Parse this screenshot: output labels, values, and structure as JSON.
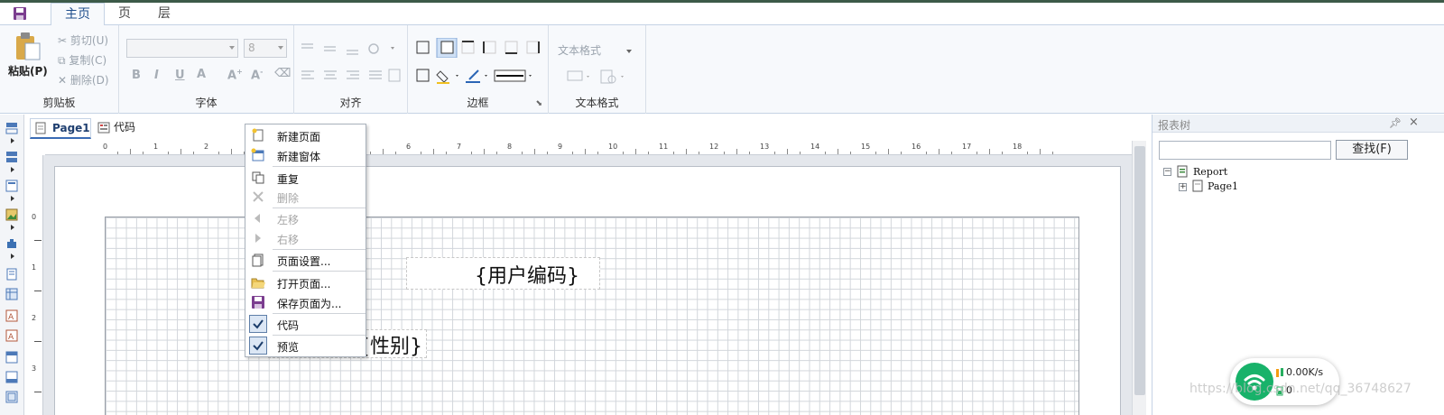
{
  "menu": {
    "tabs": [
      {
        "label": "主页",
        "active": true
      },
      {
        "label": "页",
        "active": false
      },
      {
        "label": "层",
        "active": false
      }
    ]
  },
  "ribbon": {
    "clipboard": {
      "paste": "粘贴(P)",
      "cut": "剪切(U)",
      "copy": "复制(C)",
      "delete": "删除(D)",
      "label": "剪贴板"
    },
    "font": {
      "size_value": "8",
      "label": "字体"
    },
    "align": {
      "label": "对齐"
    },
    "border": {
      "label": "边框"
    },
    "text_format": {
      "combo": "文本格式",
      "label": "文本格式"
    }
  },
  "doc_tabs": [
    {
      "label": "Page1",
      "active": true
    },
    {
      "label": "代码",
      "active": false
    }
  ],
  "ruler": {
    "h_numbers": [
      "0",
      "1",
      "2",
      "3",
      "4",
      "5",
      "6",
      "7",
      "8",
      "9",
      "10",
      "11",
      "12",
      "13",
      "14",
      "15",
      "16",
      "17",
      "18"
    ],
    "v_numbers": [
      "0",
      "1",
      "2",
      "3"
    ]
  },
  "canvas": {
    "fields": [
      "{用户编码}",
      "{性别}"
    ]
  },
  "context_menu": {
    "items": [
      {
        "label": "新建页面",
        "enabled": true
      },
      {
        "label": "新建窗体",
        "enabled": true
      },
      {
        "label": "重复",
        "enabled": true
      },
      {
        "label": "删除",
        "enabled": false
      },
      {
        "label": "左移",
        "enabled": false
      },
      {
        "label": "右移",
        "enabled": false
      },
      {
        "label": "页面设置...",
        "enabled": true
      },
      {
        "label": "打开页面...",
        "enabled": true
      },
      {
        "label": "保存页面为...",
        "enabled": true
      },
      {
        "label": "代码",
        "enabled": true,
        "checked": true
      },
      {
        "label": "预览",
        "enabled": true,
        "checked": true
      }
    ]
  },
  "report_tree": {
    "title": "报表树",
    "find_button": "查找(F)",
    "search_value": "",
    "nodes": [
      "Report",
      "Page1"
    ]
  },
  "network": {
    "speed": "0.00K/s",
    "count": "0"
  },
  "watermark": "https://blog.csdn.net/qq_36748627",
  "colors": {
    "accent": "#3a6bb5",
    "ribbon_bg": "#f7f9fc",
    "wifi_green": "#18b26a"
  }
}
